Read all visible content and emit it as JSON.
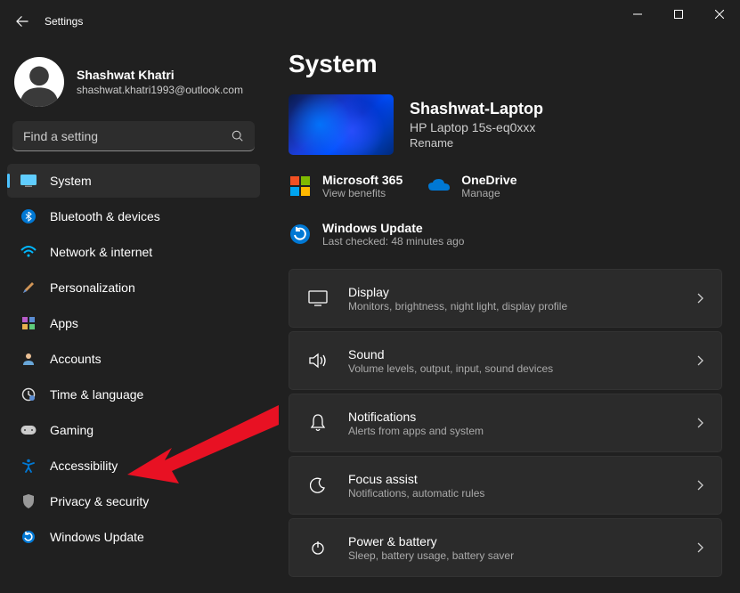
{
  "titlebar": {
    "title": "Settings"
  },
  "profile": {
    "name": "Shashwat Khatri",
    "email": "shashwat.khatri1993@outlook.com"
  },
  "search": {
    "placeholder": "Find a setting"
  },
  "sidebar": {
    "items": [
      {
        "label": "System"
      },
      {
        "label": "Bluetooth & devices"
      },
      {
        "label": "Network & internet"
      },
      {
        "label": "Personalization"
      },
      {
        "label": "Apps"
      },
      {
        "label": "Accounts"
      },
      {
        "label": "Time & language"
      },
      {
        "label": "Gaming"
      },
      {
        "label": "Accessibility"
      },
      {
        "label": "Privacy & security"
      },
      {
        "label": "Windows Update"
      }
    ]
  },
  "page": {
    "title": "System"
  },
  "device": {
    "name": "Shashwat-Laptop",
    "model": "HP Laptop 15s-eq0xxx",
    "rename": "Rename"
  },
  "quicklinks": {
    "m365": {
      "title": "Microsoft 365",
      "sub": "View benefits"
    },
    "onedrive": {
      "title": "OneDrive",
      "sub": "Manage"
    },
    "update": {
      "title": "Windows Update",
      "sub": "Last checked: 48 minutes ago"
    }
  },
  "settings": [
    {
      "title": "Display",
      "sub": "Monitors, brightness, night light, display profile"
    },
    {
      "title": "Sound",
      "sub": "Volume levels, output, input, sound devices"
    },
    {
      "title": "Notifications",
      "sub": "Alerts from apps and system"
    },
    {
      "title": "Focus assist",
      "sub": "Notifications, automatic rules"
    },
    {
      "title": "Power & battery",
      "sub": "Sleep, battery usage, battery saver"
    }
  ]
}
